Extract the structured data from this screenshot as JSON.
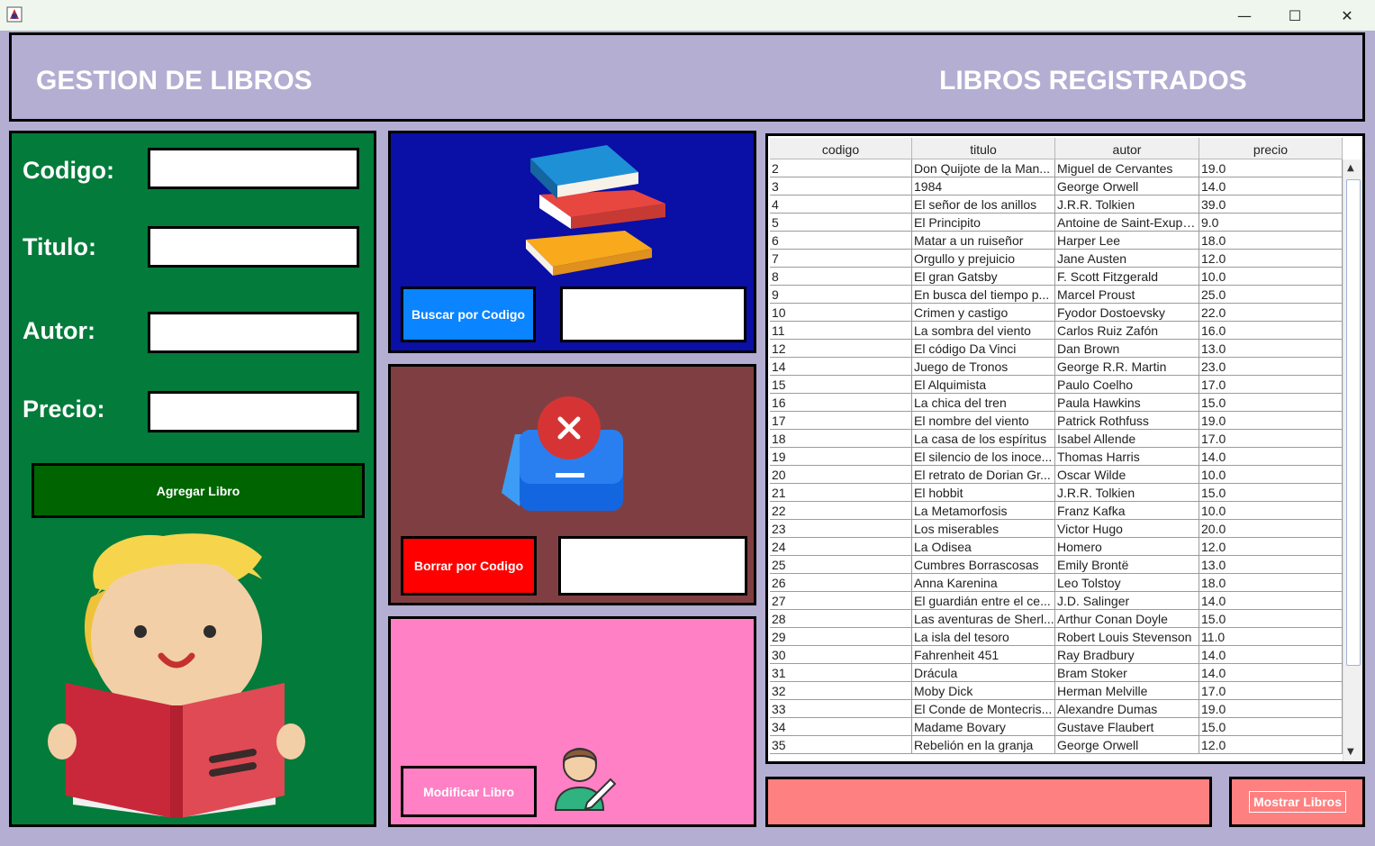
{
  "window": {
    "minimize_glyph": "—",
    "maximize_glyph": "☐",
    "close_glyph": "✕"
  },
  "header": {
    "left_title": "GESTION DE LIBROS",
    "right_title": "LIBROS REGISTRADOS"
  },
  "form": {
    "codigo_label": "Codigo:",
    "titulo_label": "Titulo:",
    "autor_label": "Autor:",
    "precio_label": "Precio:",
    "codigo_value": "",
    "titulo_value": "",
    "autor_value": "",
    "precio_value": "",
    "add_button": "Agregar Libro"
  },
  "search": {
    "button": "Buscar por Codigo",
    "value": ""
  },
  "delete": {
    "button": "Borrar por Codigo",
    "value": ""
  },
  "modify": {
    "button": "Modificar Libro"
  },
  "table": {
    "headers": [
      "codigo",
      "titulo",
      "autor",
      "precio"
    ],
    "rows": [
      [
        "2",
        "Don Quijote de la Man...",
        "Miguel de Cervantes",
        "19.0"
      ],
      [
        "3",
        "1984",
        "George Orwell",
        "14.0"
      ],
      [
        "4",
        "El señor de los anillos",
        "J.R.R. Tolkien",
        "39.0"
      ],
      [
        "5",
        "El Principito",
        "Antoine de Saint-Exupé...",
        "9.0"
      ],
      [
        "6",
        "Matar a un ruiseñor",
        "Harper Lee",
        "18.0"
      ],
      [
        "7",
        "Orgullo y prejuicio",
        "Jane Austen",
        "12.0"
      ],
      [
        "8",
        "El gran Gatsby",
        "F. Scott Fitzgerald",
        "10.0"
      ],
      [
        "9",
        "En busca del tiempo p...",
        "Marcel Proust",
        "25.0"
      ],
      [
        "10",
        "Crimen y castigo",
        "Fyodor Dostoevsky",
        "22.0"
      ],
      [
        "11",
        "La sombra del viento",
        "Carlos Ruiz Zafón",
        "16.0"
      ],
      [
        "12",
        "El código Da Vinci",
        "Dan Brown",
        "13.0"
      ],
      [
        "14",
        "Juego de Tronos",
        "George R.R. Martin",
        "23.0"
      ],
      [
        "15",
        "El Alquimista",
        "Paulo Coelho",
        "17.0"
      ],
      [
        "16",
        "La chica del tren",
        "Paula Hawkins",
        "15.0"
      ],
      [
        "17",
        "El nombre del viento",
        "Patrick Rothfuss",
        "19.0"
      ],
      [
        "18",
        "La casa de los espíritus",
        "Isabel Allende",
        "17.0"
      ],
      [
        "19",
        "El silencio de los inoce...",
        "Thomas Harris",
        "14.0"
      ],
      [
        "20",
        "El retrato de Dorian Gr...",
        "Oscar Wilde",
        "10.0"
      ],
      [
        "21",
        "El hobbit",
        "J.R.R. Tolkien",
        "15.0"
      ],
      [
        "22",
        "La Metamorfosis",
        "Franz Kafka",
        "10.0"
      ],
      [
        "23",
        "Los miserables",
        "Victor Hugo",
        "20.0"
      ],
      [
        "24",
        "La Odisea",
        "Homero",
        "12.0"
      ],
      [
        "25",
        "Cumbres Borrascosas",
        "Emily Brontë",
        "13.0"
      ],
      [
        "26",
        "Anna Karenina",
        "Leo Tolstoy",
        "18.0"
      ],
      [
        "27",
        "El guardián entre el ce...",
        "J.D. Salinger",
        "14.0"
      ],
      [
        "28",
        "Las aventuras de Sherl...",
        "Arthur Conan Doyle",
        "15.0"
      ],
      [
        "29",
        "La isla del tesoro",
        "Robert Louis Stevenson",
        "11.0"
      ],
      [
        "30",
        "Fahrenheit 451",
        "Ray Bradbury",
        "14.0"
      ],
      [
        "31",
        "Drácula",
        "Bram Stoker",
        "14.0"
      ],
      [
        "32",
        "Moby Dick",
        "Herman Melville",
        "17.0"
      ],
      [
        "33",
        "El Conde de Montecris...",
        "Alexandre Dumas",
        "19.0"
      ],
      [
        "34",
        "Madame Bovary",
        "Gustave Flaubert",
        "15.0"
      ],
      [
        "35",
        "Rebelión en la granja",
        "George Orwell",
        "12.0"
      ]
    ]
  },
  "show_button": "Mostrar Libros",
  "colors": {
    "background": "#b3aed2",
    "green_panel": "#037b3a",
    "add_button": "#006400",
    "blue_panel": "#0a0fa6",
    "search_button": "#0a84ff",
    "maroon_panel": "#7f3f42",
    "delete_button": "#ff0000",
    "pink_panel": "#ff80c4",
    "salmon": "#ff8080"
  },
  "icons": {
    "app": "java-app-icon",
    "books": "books-stack-icon",
    "delete": "delete-inbox-icon",
    "edit": "person-edit-icon",
    "reader": "child-reading-illustration"
  }
}
